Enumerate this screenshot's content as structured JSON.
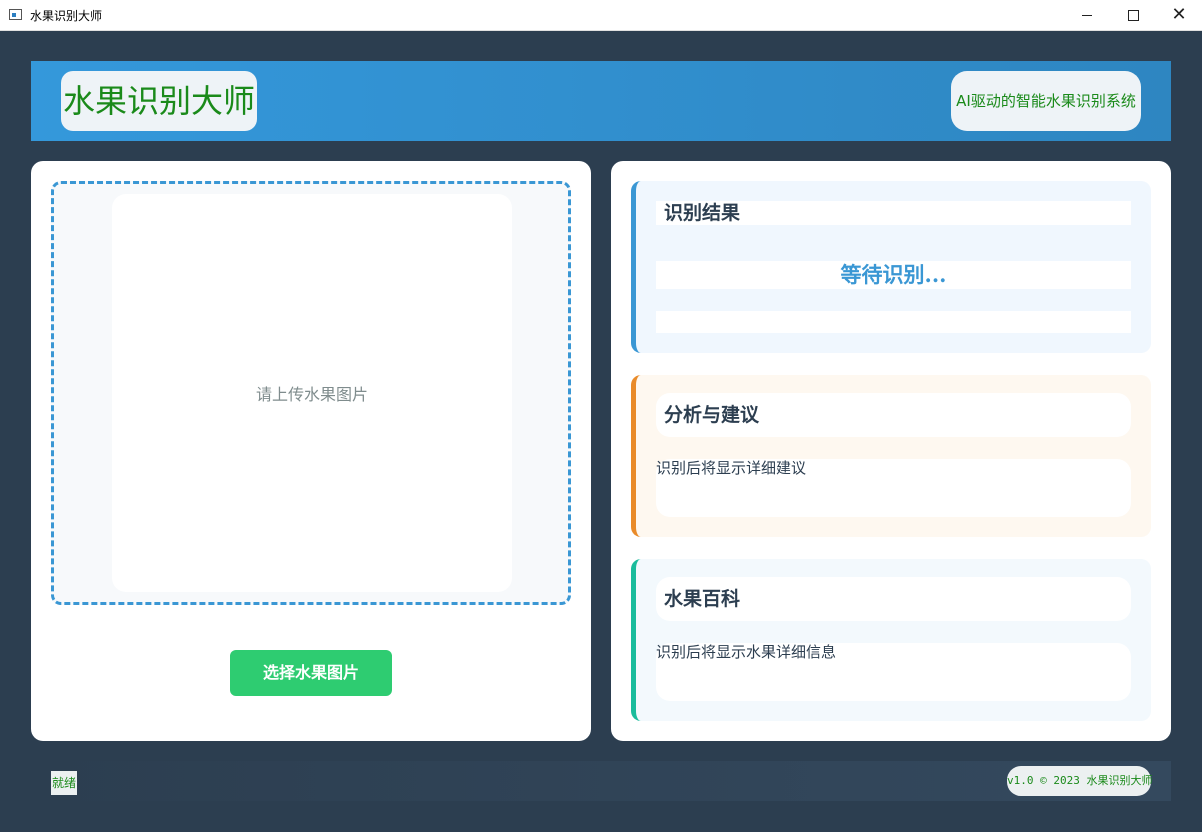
{
  "window": {
    "title": "水果识别大师",
    "minimize_icon": "minimize-icon",
    "maximize_icon": "maximize-icon",
    "close_icon": "close-icon"
  },
  "header": {
    "app_name": "水果识别大师",
    "tagline": "AI驱动的智能水果识别系统"
  },
  "left_panel": {
    "placeholder": "请上传水果图片",
    "select_button": "选择水果图片"
  },
  "result_card": {
    "title": "识别结果",
    "value": "等待识别..."
  },
  "advice_card": {
    "title": "分析与建议",
    "body": "识别后将显示详细建议"
  },
  "encyclopedia_card": {
    "title": "水果百科",
    "body": "识别后将显示水果详细信息"
  },
  "status_bar": {
    "status": "就绪",
    "version": "v1.0 © 2023 水果识别大师"
  },
  "colors": {
    "background": "#2c3e50",
    "header": "#3498db",
    "accent_blue": "#3a97d4",
    "accent_orange": "#e98b2a",
    "accent_teal": "#1abc9c",
    "button_green": "#2ecc71",
    "label_green": "#1a8a1a"
  }
}
